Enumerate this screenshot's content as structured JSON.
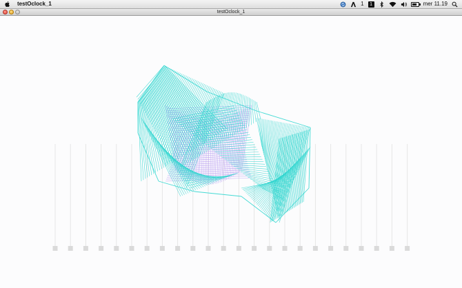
{
  "menubar": {
    "app_name": "testOclock_1",
    "status_a": "1",
    "status_b": "1",
    "clock": "mer 11.19"
  },
  "window": {
    "title": "testOclock_1"
  },
  "colors": {
    "mesh_primary": "#2fd6cf",
    "mesh_secondary": "#b69af0",
    "track": "#e6e6e6",
    "slider_knob": "#dadada",
    "canvas_bg": "#fcfcfd"
  },
  "icons": [
    "apple-icon",
    "sync-icon",
    "adobe-icon",
    "bluetooth-icon",
    "wifi-icon",
    "volume-icon",
    "battery-icon",
    "search-icon"
  ],
  "sliders": {
    "count": 24
  }
}
